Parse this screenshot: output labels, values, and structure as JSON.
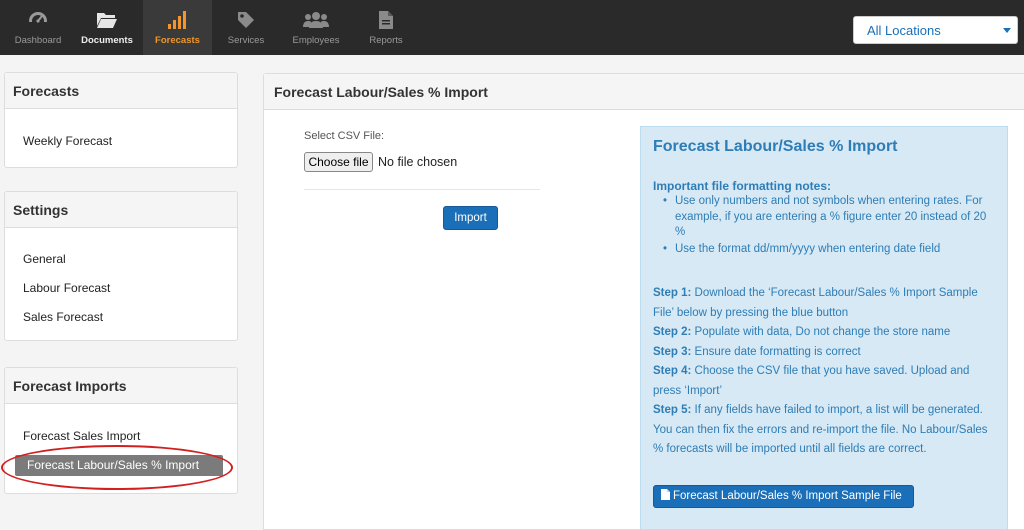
{
  "nav": {
    "items": [
      {
        "label": "Dashboard",
        "icon": "dashboard-gauge-icon"
      },
      {
        "label": "Documents",
        "icon": "folder-open-icon"
      },
      {
        "label": "Forecasts",
        "icon": "bar-chart-icon"
      },
      {
        "label": "Services",
        "icon": "tag-icon"
      },
      {
        "label": "Employees",
        "icon": "users-icon"
      },
      {
        "label": "Reports",
        "icon": "file-icon"
      }
    ],
    "active_index": 2,
    "location_select": "All Locations"
  },
  "sidebar": {
    "forecasts": {
      "title": "Forecasts",
      "items": [
        "Weekly Forecast"
      ]
    },
    "settings": {
      "title": "Settings",
      "items": [
        "General",
        "Labour Forecast",
        "Sales Forecast"
      ]
    },
    "imports": {
      "title": "Forecast Imports",
      "items": [
        "Forecast Sales Import",
        "Forecast Labour/Sales % Import"
      ],
      "active_index": 1
    }
  },
  "main": {
    "title": "Forecast Labour/Sales % Import",
    "csv_label": "Select CSV File:",
    "choose_file": "Choose file",
    "file_status": "No file chosen",
    "import_button": "Import"
  },
  "info": {
    "title": "Forecast Labour/Sales % Import",
    "notes_heading": "Important file formatting notes:",
    "notes": [
      "Use only numbers and not symbols when entering rates. For example, if you are entering a % figure enter 20 instead of 20 %",
      "Use the format dd/mm/yyyy when entering date field"
    ],
    "steps": [
      {
        "label": "Step 1:",
        "text": "Download the ‘Forecast Labour/Sales % Import Sample File’ below by pressing the blue button"
      },
      {
        "label": "Step 2:",
        "text": "Populate with data, Do not change the store name"
      },
      {
        "label": "Step 3:",
        "text": "Ensure date formatting is correct"
      },
      {
        "label": "Step 4:",
        "text": "Choose the CSV file that you have saved. Upload and press ‘Import’"
      },
      {
        "label": "Step 5:",
        "text": "If any fields have failed to import, a list will be generated. You can then fix the errors and re-import the file. No Labour/Sales % forecasts will be imported until all fields are correct."
      }
    ],
    "sample_button": "Forecast Labour/Sales % Import Sample File"
  },
  "colors": {
    "accent_blue": "#1a6fb8",
    "info_text": "#2e7db6",
    "info_bg": "#d6e9f5",
    "nav_active": "#f0962b",
    "nav_bg": "#2a2a2a",
    "annotation_red": "#d22020"
  }
}
